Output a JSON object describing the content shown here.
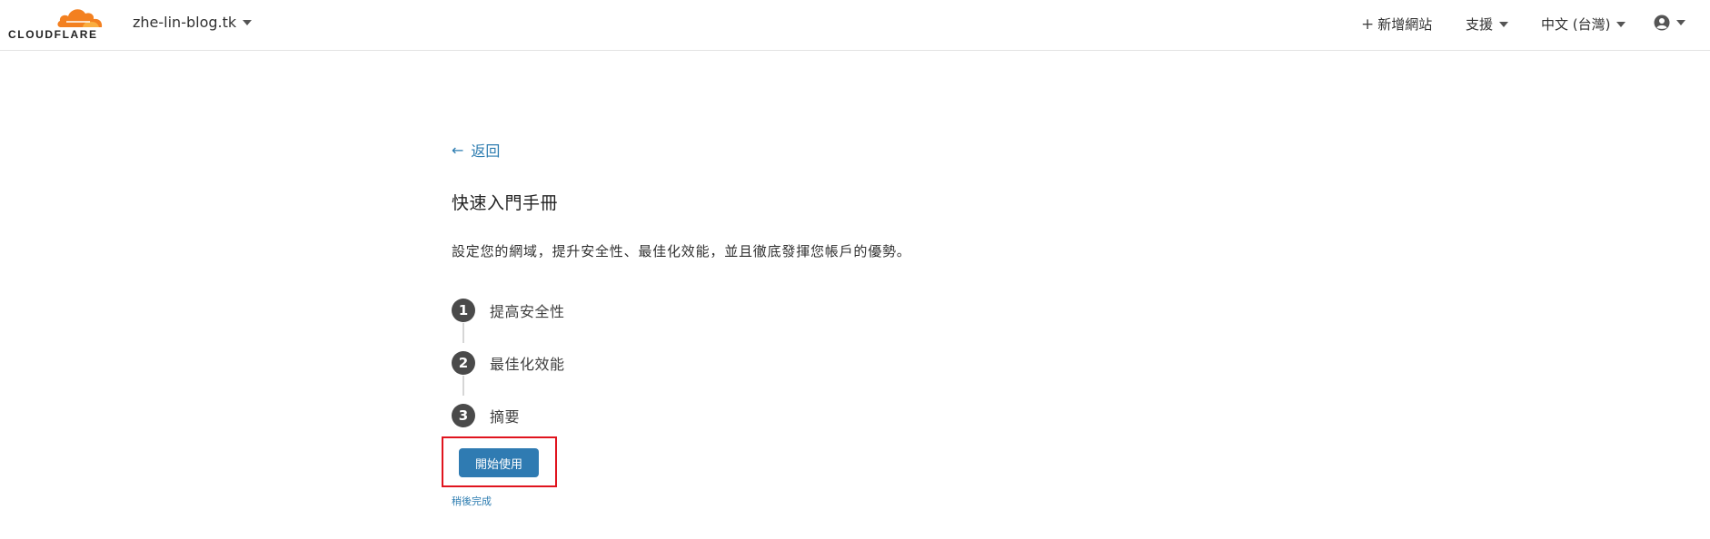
{
  "header": {
    "logo_text": "CLOUDFLARE",
    "domain": "zhe-lin-blog.tk",
    "add_site": "新增網站",
    "support": "支援",
    "language": "中文 (台灣)"
  },
  "main": {
    "back": "返回",
    "title": "快速入門手冊",
    "description": "設定您的網域，提升安全性、最佳化效能，並且徹底發揮您帳戶的優勢。",
    "steps": [
      {
        "num": "1",
        "label": "提高安全性"
      },
      {
        "num": "2",
        "label": "最佳化效能"
      },
      {
        "num": "3",
        "label": "摘要"
      }
    ],
    "start_button": "開始使用",
    "later_link": "稍後完成"
  },
  "colors": {
    "accent": "#2f7bb2",
    "link": "#2c7cb0",
    "highlight": "#e0141e",
    "brand_orange": "#f38020"
  },
  "icons": {
    "logo": "cloudflare-cloud-icon",
    "add": "plus-icon",
    "dropdown": "caret-down-icon",
    "account": "user-circle-icon",
    "back": "arrow-left-icon"
  }
}
